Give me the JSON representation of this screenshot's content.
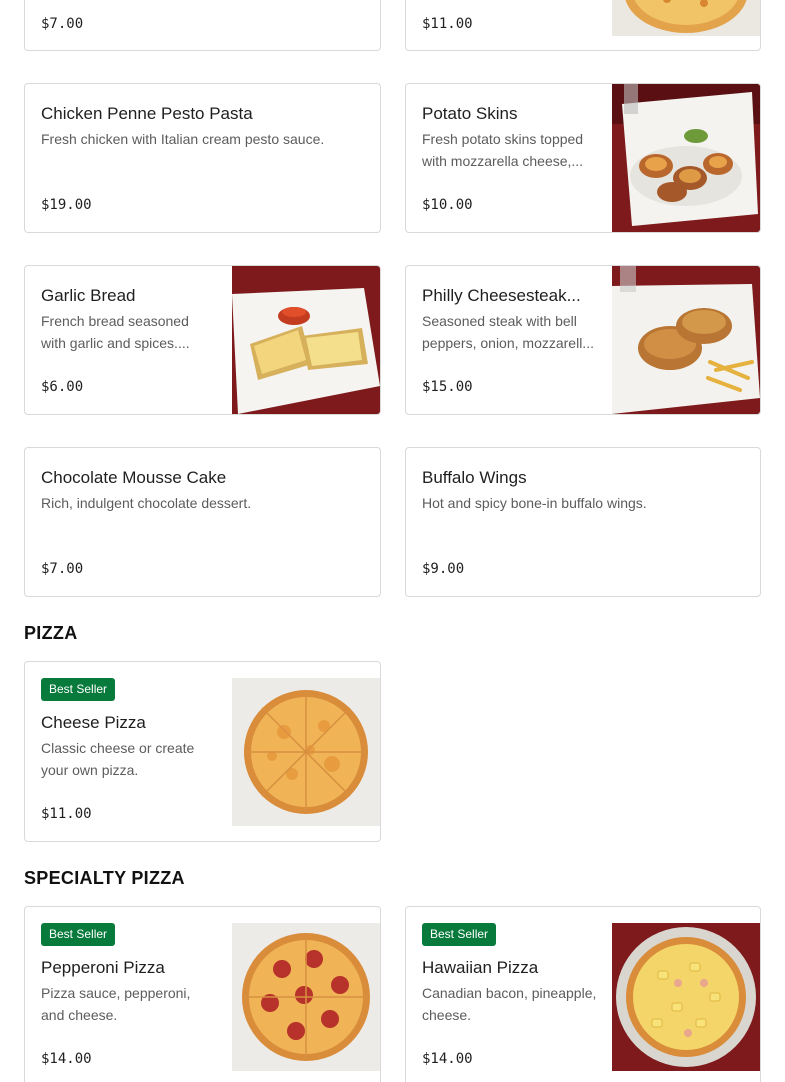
{
  "top_cards": [
    {
      "price": "$7.00"
    },
    {
      "price": "$11.00"
    }
  ],
  "items": {
    "chicken_penne": {
      "name": "Chicken Penne Pesto Pasta",
      "desc": "Fresh chicken with Italian cream pesto sauce.",
      "price": "$19.00"
    },
    "potato_skins": {
      "name": "Potato Skins",
      "desc": "Fresh potato skins topped with mozzarella cheese,...",
      "price": "$10.00"
    },
    "garlic_bread": {
      "name": "Garlic Bread",
      "desc": "French bread seasoned with garlic and spices....",
      "price": "$6.00"
    },
    "philly": {
      "name": "Philly Cheesesteak...",
      "desc": "Seasoned steak with bell peppers, onion, mozzarell...",
      "price": "$15.00"
    },
    "mousse": {
      "name": "Chocolate Mousse Cake",
      "desc": "Rich, indulgent chocolate dessert.",
      "price": "$7.00"
    },
    "wings": {
      "name": "Buffalo Wings",
      "desc": "Hot and spicy bone-in buffalo wings.",
      "price": "$9.00"
    },
    "cheese_pizza": {
      "badge": "Best Seller",
      "name": "Cheese Pizza",
      "desc": "Classic cheese or create your own pizza.",
      "price": "$11.00"
    },
    "pepperoni": {
      "badge": "Best Seller",
      "name": "Pepperoni Pizza",
      "desc": "Pizza sauce, pepperoni, and cheese.",
      "price": "$14.00"
    },
    "hawaiian": {
      "badge": "Best Seller",
      "name": "Hawaiian Pizza",
      "desc": "Canadian bacon, pineapple, cheese.",
      "price": "$14.00"
    }
  },
  "sections": {
    "pizza": "PIZZA",
    "specialty": "SPECIALTY PIZZA"
  },
  "colors": {
    "badge": "#087a3c",
    "card_border": "#d9d9d9",
    "table_red": "#8e1b1f"
  },
  "icons": {
    "food_photo": "photo"
  }
}
